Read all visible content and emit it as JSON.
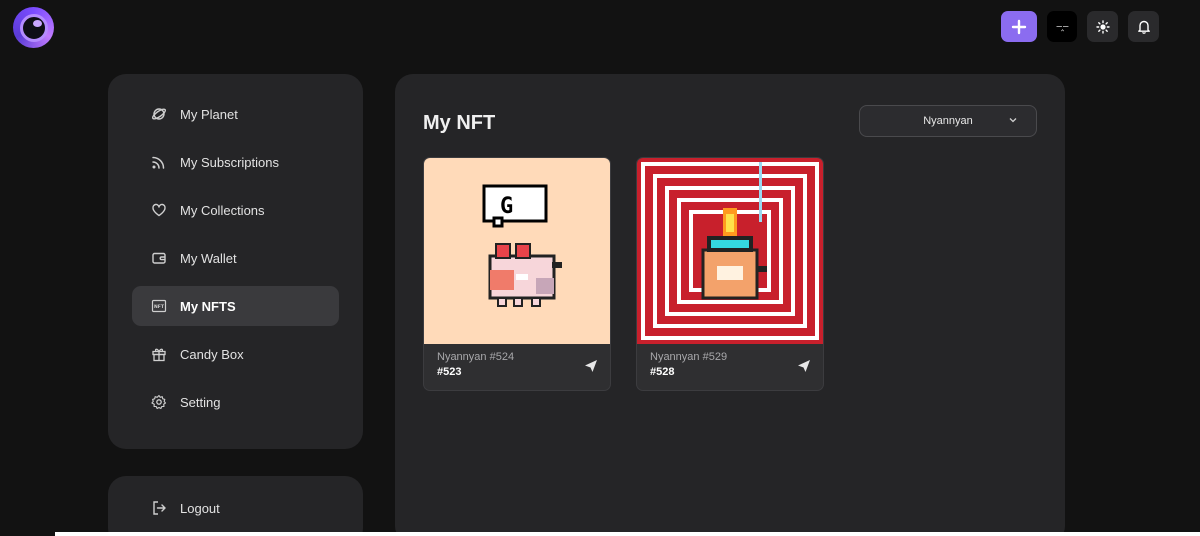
{
  "header": {
    "avatar_text": "—‸—"
  },
  "sidebar": {
    "items": [
      {
        "label": "My Planet",
        "icon": "planet-icon",
        "active": false
      },
      {
        "label": "My Subscriptions",
        "icon": "rss-icon",
        "active": false
      },
      {
        "label": "My Collections",
        "icon": "heart-icon",
        "active": false
      },
      {
        "label": "My Wallet",
        "icon": "wallet-icon",
        "active": false
      },
      {
        "label": "My NFTS",
        "icon": "nft-icon",
        "active": true
      },
      {
        "label": "Candy Box",
        "icon": "gift-icon",
        "active": false
      },
      {
        "label": "Setting",
        "icon": "gear-icon",
        "active": false
      }
    ],
    "logout_label": "Logout"
  },
  "main": {
    "title": "My NFT",
    "collection_select": "Nyannyan",
    "nfts": [
      {
        "name": "Nyannyan #524",
        "token": "#523",
        "bg": "#ffdab9"
      },
      {
        "name": "Nyannyan #529",
        "token": "#528",
        "bg": "#c8202c"
      }
    ]
  },
  "colors": {
    "accent": "#8b6cf0",
    "panel": "#252527",
    "background": "#121212"
  }
}
